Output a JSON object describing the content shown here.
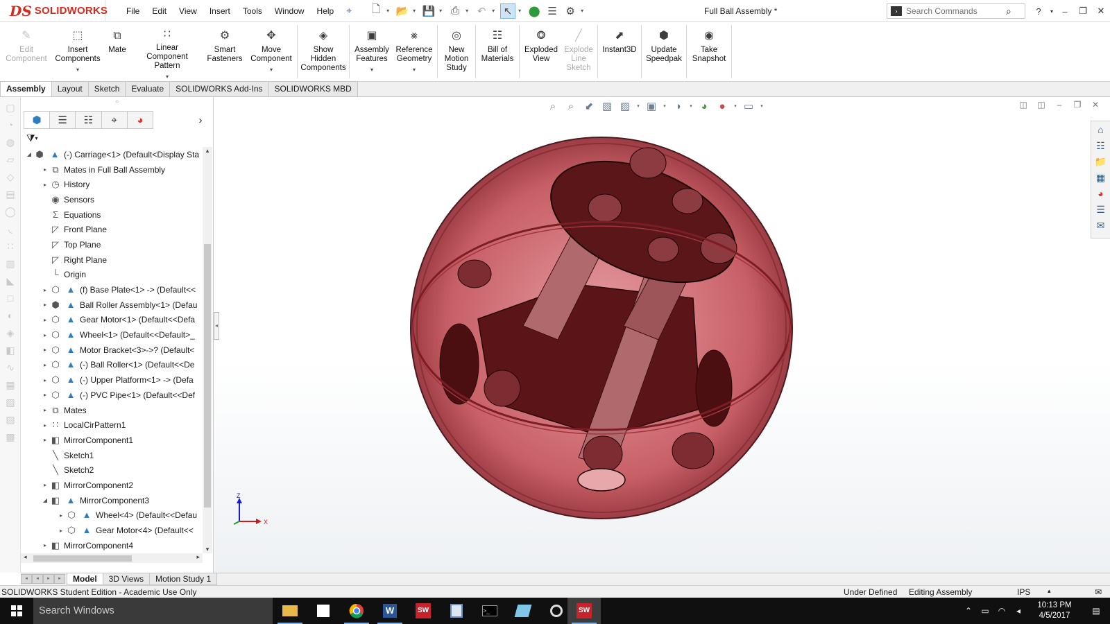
{
  "app": {
    "logo_ds": "DS",
    "logo_text": "SOLIDWORKS",
    "menus": [
      "File",
      "Edit",
      "View",
      "Insert",
      "Tools",
      "Window",
      "Help"
    ],
    "document_title": "Full Ball Assembly *",
    "search_placeholder": "Search Commands"
  },
  "ribbon": [
    {
      "label": "Edit Component",
      "icon": "edit-component-icon",
      "disabled": true
    },
    {
      "label": "Insert Components",
      "icon": "insert-components-icon",
      "dropdown": true
    },
    {
      "label": "Mate",
      "icon": "mate-icon"
    },
    {
      "label": "Linear Component Pattern",
      "icon": "linear-pattern-icon",
      "dropdown": true
    },
    {
      "label": "Smart Fasteners",
      "icon": "smart-fasteners-icon"
    },
    {
      "label": "Move Component",
      "icon": "move-component-icon",
      "dropdown": true
    },
    {
      "label": "Show Hidden Components",
      "icon": "show-hidden-icon"
    },
    {
      "label": "Assembly Features",
      "icon": "assembly-features-icon",
      "dropdown": true
    },
    {
      "label": "Reference Geometry",
      "icon": "reference-geometry-icon",
      "dropdown": true
    },
    {
      "label": "New Motion Study",
      "icon": "motion-study-icon"
    },
    {
      "label": "Bill of Materials",
      "icon": "bom-icon"
    },
    {
      "label": "Exploded View",
      "icon": "exploded-view-icon"
    },
    {
      "label": "Explode Line Sketch",
      "icon": "explode-line-icon",
      "disabled": true
    },
    {
      "label": "Instant3D",
      "icon": "instant3d-icon"
    },
    {
      "label": "Update Speedpak",
      "icon": "speedpak-icon"
    },
    {
      "label": "Take Snapshot",
      "icon": "snapshot-icon"
    }
  ],
  "tabs": [
    "Assembly",
    "Layout",
    "Sketch",
    "Evaluate",
    "SOLIDWORKS Add-Ins",
    "SOLIDWORKS MBD"
  ],
  "active_tab": "Assembly",
  "tree": [
    {
      "label": "(-) Carriage<1> (Default<Display Sta",
      "level": 0,
      "expander": "open",
      "icon": "assembly-icon"
    },
    {
      "label": "Mates in Full Ball Assembly",
      "level": 1,
      "expander": "closed",
      "icon": "mates-folder-icon"
    },
    {
      "label": "History",
      "level": 1,
      "expander": "closed",
      "icon": "history-icon"
    },
    {
      "label": "Sensors",
      "level": 1,
      "expander": "none",
      "icon": "sensors-icon"
    },
    {
      "label": "Equations",
      "level": 1,
      "expander": "none",
      "icon": "equations-icon"
    },
    {
      "label": "Front Plane",
      "level": 1,
      "expander": "none",
      "icon": "plane-icon"
    },
    {
      "label": "Top Plane",
      "level": 1,
      "expander": "none",
      "icon": "plane-icon"
    },
    {
      "label": "Right Plane",
      "level": 1,
      "expander": "none",
      "icon": "plane-icon"
    },
    {
      "label": "Origin",
      "level": 1,
      "expander": "none",
      "icon": "origin-icon"
    },
    {
      "label": "(f) Base Plate<1> -> (Default<<",
      "level": 1,
      "expander": "closed",
      "icon": "part-icon"
    },
    {
      "label": "Ball Roller Assembly<1> (Defau",
      "level": 1,
      "expander": "closed",
      "icon": "assembly-icon"
    },
    {
      "label": "Gear Motor<1> (Default<<Defa",
      "level": 1,
      "expander": "closed",
      "icon": "part-icon"
    },
    {
      "label": "Wheel<1> (Default<<Default>_",
      "level": 1,
      "expander": "closed",
      "icon": "part-icon"
    },
    {
      "label": "Motor Bracket<3>->? (Default<",
      "level": 1,
      "expander": "closed",
      "icon": "part-icon"
    },
    {
      "label": "(-) Ball Roller<1> (Default<<De",
      "level": 1,
      "expander": "closed",
      "icon": "part-icon"
    },
    {
      "label": "(-) Upper Platform<1> -> (Defa",
      "level": 1,
      "expander": "closed",
      "icon": "part-icon"
    },
    {
      "label": "(-) PVC Pipe<1> (Default<<Def",
      "level": 1,
      "expander": "closed",
      "icon": "part-icon"
    },
    {
      "label": "Mates",
      "level": 1,
      "expander": "closed",
      "icon": "mates-icon"
    },
    {
      "label": "LocalCirPattern1",
      "level": 1,
      "expander": "closed",
      "icon": "pattern-icon"
    },
    {
      "label": "MirrorComponent1",
      "level": 1,
      "expander": "closed",
      "icon": "mirror-icon"
    },
    {
      "label": "Sketch1",
      "level": 1,
      "expander": "none",
      "icon": "sketch-icon"
    },
    {
      "label": "Sketch2",
      "level": 1,
      "expander": "none",
      "icon": "sketch-icon"
    },
    {
      "label": "MirrorComponent2",
      "level": 1,
      "expander": "closed",
      "icon": "mirror-icon"
    },
    {
      "label": "MirrorComponent3",
      "level": 1,
      "expander": "open",
      "icon": "mirror-icon"
    },
    {
      "label": "Wheel<4> (Default<<Defau",
      "level": 2,
      "expander": "closed",
      "icon": "part-icon"
    },
    {
      "label": "Gear Motor<4> (Default<<",
      "level": 2,
      "expander": "closed",
      "icon": "part-icon"
    },
    {
      "label": "MirrorComponent4",
      "level": 1,
      "expander": "closed",
      "icon": "mirror-icon"
    }
  ],
  "bottom_tabs": [
    "Model",
    "3D Views",
    "Motion Study 1"
  ],
  "active_bottom_tab": "Model",
  "status": {
    "edition": "SOLIDWORKS Student Edition - Academic Use Only",
    "state": "Under Defined",
    "mode": "Editing Assembly",
    "units": "IPS"
  },
  "triad": {
    "z": "Z",
    "x": "X"
  },
  "taskbar": {
    "search_placeholder": "Search Windows",
    "apps": [
      "file-explorer-icon",
      "store-icon",
      "chrome-icon",
      "word-icon",
      "solidworks-2016-icon",
      "installer-icon",
      "terminal-icon",
      "notes-icon",
      "capture-icon",
      "solidworks-active-icon"
    ],
    "time": "10:13 PM",
    "date": "4/5/2017"
  },
  "colors": {
    "accent": "#d52b1e",
    "ball": "#c04850",
    "ball_dark": "#5b1518"
  }
}
